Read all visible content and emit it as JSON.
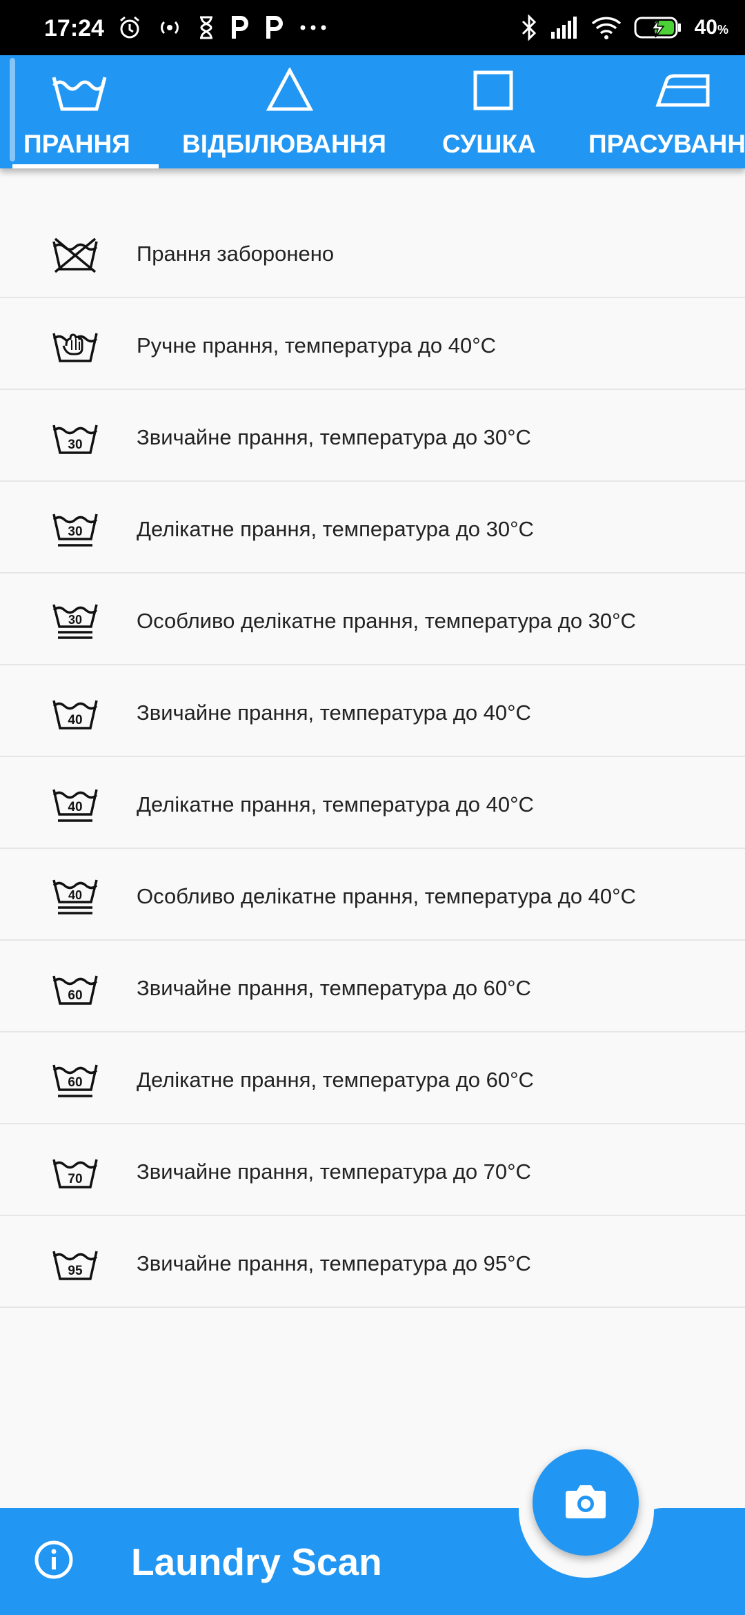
{
  "status_bar": {
    "time": "17:24",
    "battery": "40",
    "battery_unit": "%",
    "left_icons": [
      "alarm-icon",
      "hotspot-icon",
      "hourglass-icon",
      "p-icon",
      "p-icon",
      "more-dots-icon"
    ],
    "right_icons": [
      "bluetooth-icon",
      "signal-icon",
      "wifi-icon",
      "battery-charging-icon"
    ]
  },
  "tabs": [
    {
      "label": "ПРАННЯ",
      "icon": "washtub-icon",
      "selected": true
    },
    {
      "label": "ВІДБІЛЮВАННЯ",
      "icon": "triangle-icon"
    },
    {
      "label": "СУШКА",
      "icon": "square-icon"
    },
    {
      "label": "ПРАСУВАННЯ",
      "icon": "iron-icon"
    }
  ],
  "items": [
    {
      "text": "Прання заборонено",
      "icon": "do-not-wash-icon"
    },
    {
      "text": "Ручне прання, температура до 40°C",
      "icon": "hand-wash-icon"
    },
    {
      "text": "Звичайне прання, температура до 30°C",
      "icon": "wash-30-icon",
      "temp": "30"
    },
    {
      "text": "Делікатне прання, температура до 30°C",
      "icon": "wash-30-gentle-icon",
      "temp": "30"
    },
    {
      "text": "Особливо делікатне прання, температура до 30°C",
      "icon": "wash-30-very-gentle-icon",
      "temp": "30"
    },
    {
      "text": "Звичайне прання, температура до 40°C",
      "icon": "wash-40-icon",
      "temp": "40"
    },
    {
      "text": "Делікатне прання, температура до 40°C",
      "icon": "wash-40-gentle-icon",
      "temp": "40"
    },
    {
      "text": "Особливо делікатне прання, температура до 40°C",
      "icon": "wash-40-very-gentle-icon",
      "temp": "40"
    },
    {
      "text": "Звичайне прання, температура до 60°C",
      "icon": "wash-60-icon",
      "temp": "60"
    },
    {
      "text": "Делікатне прання, температура до 60°C",
      "icon": "wash-60-gentle-icon",
      "temp": "60"
    },
    {
      "text": "Звичайне прання, температура до 70°C",
      "icon": "wash-70-icon",
      "temp": "70"
    },
    {
      "text": "Звичайне прання, температура до 95°C",
      "icon": "wash-95-icon",
      "temp": "95"
    }
  ],
  "bottom_bar": {
    "title": "Laundry Scan",
    "info_icon": "info-icon",
    "fab_icon": "camera-icon"
  },
  "colors": {
    "primary": "#2196F3",
    "background": "#f9f9f9",
    "text": "#222222"
  }
}
